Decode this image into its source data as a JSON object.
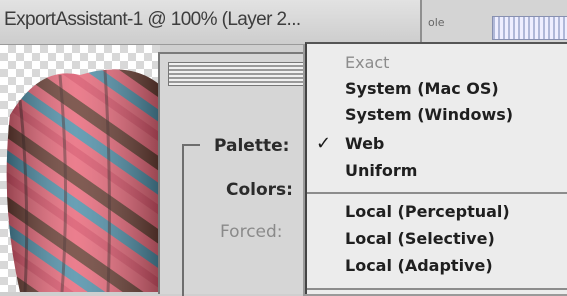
{
  "window": {
    "title": "ExportAssistant-1 @ 100% (Layer 2...",
    "background_tab_fragment": "ole"
  },
  "dialog": {
    "labels": {
      "palette": "Palette:",
      "colors": "Colors:",
      "forced": "Forced:"
    }
  },
  "palette_menu": {
    "check_glyph": "✓",
    "selected": "Web",
    "items": [
      {
        "label": "Exact",
        "enabled": false
      },
      {
        "label": "System (Mac OS)",
        "enabled": true
      },
      {
        "label": "System (Windows)",
        "enabled": true
      },
      {
        "label": "Web",
        "enabled": true,
        "checked": true
      },
      {
        "label": "Uniform",
        "enabled": true
      },
      {
        "label": "Local (Perceptual)",
        "enabled": true
      },
      {
        "label": "Local (Selective)",
        "enabled": true
      },
      {
        "label": "Local (Adaptive)",
        "enabled": true
      }
    ]
  },
  "colors": {
    "menu_bg": "#ececec",
    "dialog_bg": "#d6d6d6",
    "yarn_pink": "#e8687a",
    "yarn_blue": "#4f8fa8",
    "yarn_brown": "#6b3f35"
  }
}
